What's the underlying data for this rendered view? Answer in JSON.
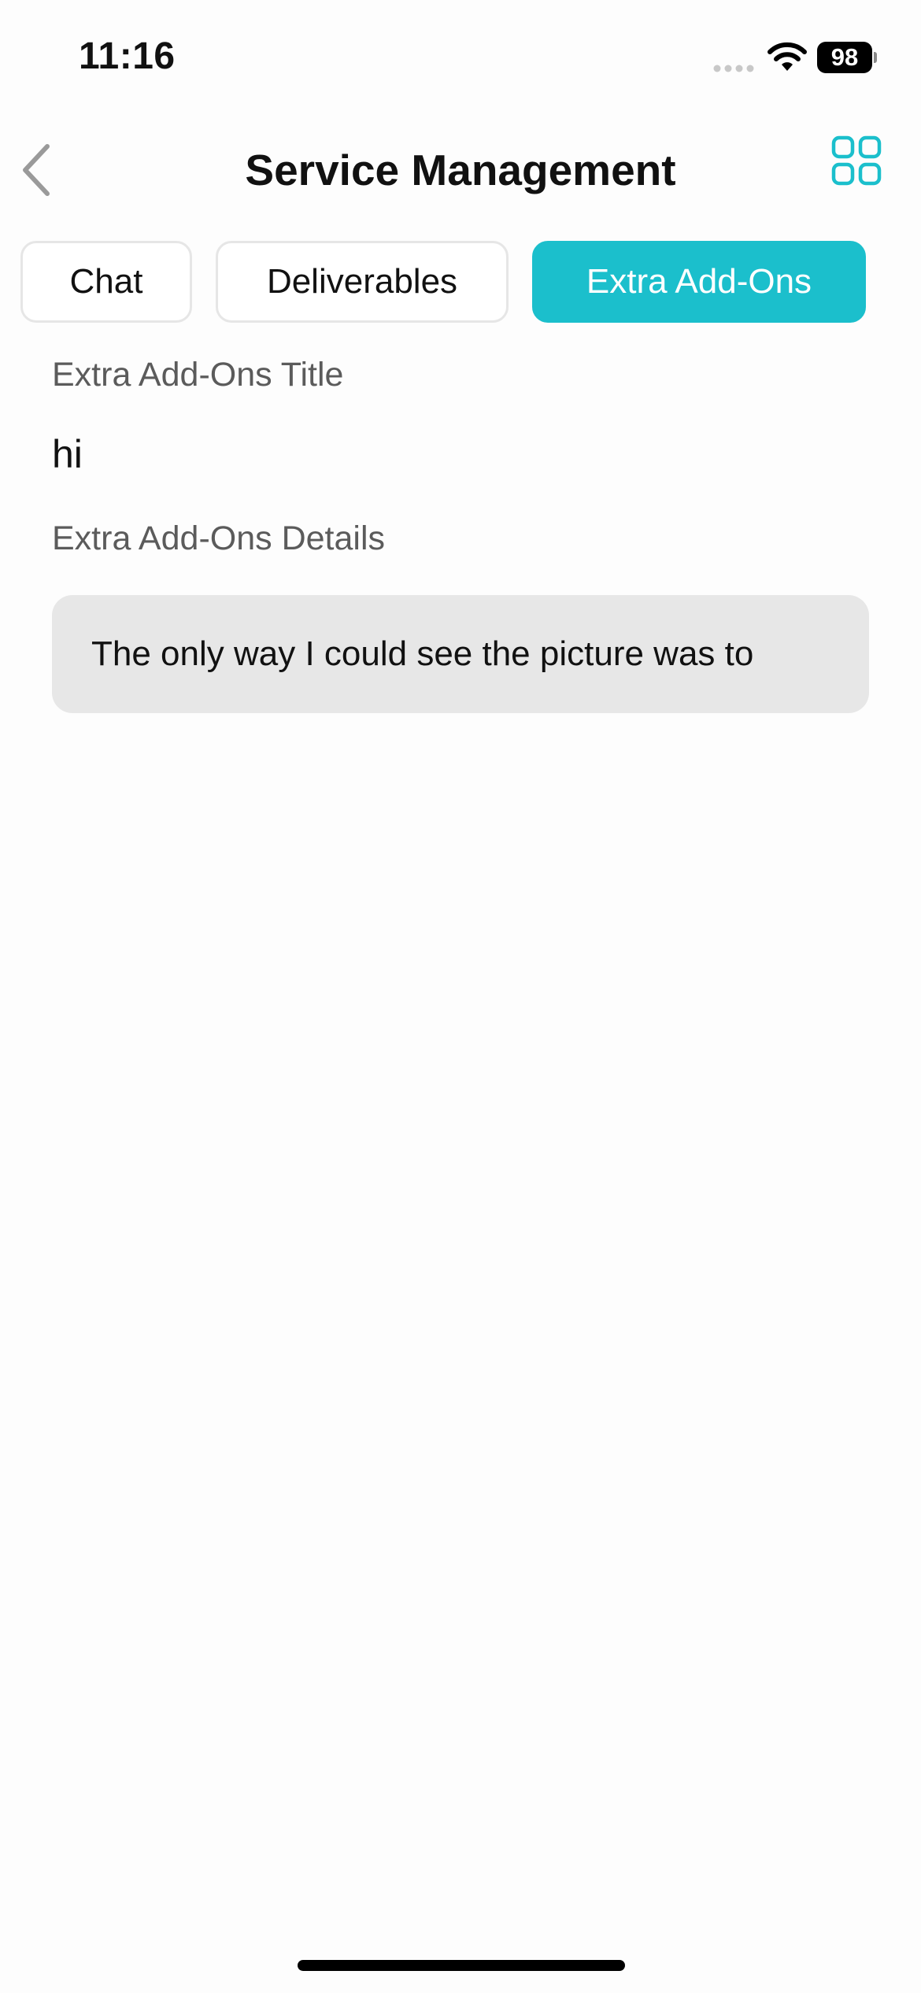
{
  "status_bar": {
    "time": "11:16",
    "battery": "98"
  },
  "nav": {
    "title": "Service Management",
    "back_icon": "chevron-left-icon",
    "menu_icon": "grid-icon"
  },
  "tabs": [
    {
      "label": "Chat",
      "active": false
    },
    {
      "label": "Deliverables",
      "active": false
    },
    {
      "label": "Extra Add-Ons",
      "active": true
    }
  ],
  "content": {
    "title_label": "Extra Add-Ons Title",
    "title_value": "hi",
    "details_label": "Extra Add-Ons Details",
    "details_value": "The only way I could see the picture was to"
  },
  "colors": {
    "accent": "#1bbfcc",
    "background": "#fdfdfd",
    "details_box": "#e7e7e7"
  }
}
